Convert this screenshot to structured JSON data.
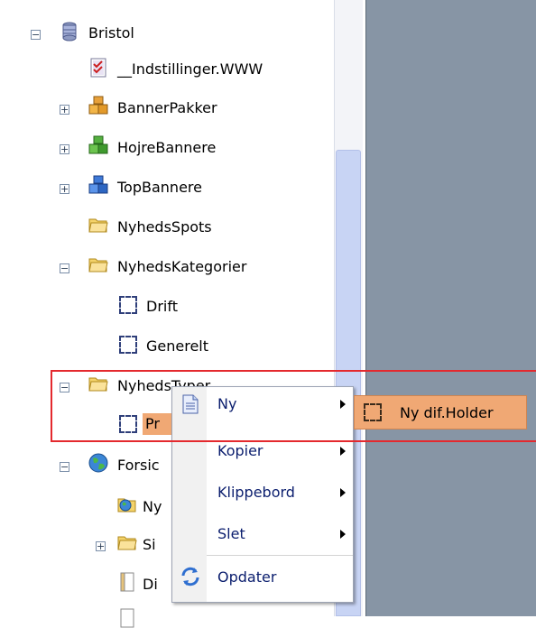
{
  "tree": {
    "root": {
      "label": "Bristol"
    },
    "items": [
      {
        "label": "__Indstillinger.WWW"
      },
      {
        "label": "BannerPakker"
      },
      {
        "label": "HojreBannere"
      },
      {
        "label": "TopBannere"
      },
      {
        "label": "NyhedsSpots"
      },
      {
        "label": "NyhedsKategorier"
      },
      {
        "label": "Drift"
      },
      {
        "label": "Generelt"
      },
      {
        "label": "NyhedsTyper"
      },
      {
        "label": "Pr"
      },
      {
        "label": "Forsic"
      },
      {
        "label": "Ny"
      },
      {
        "label": "Si"
      },
      {
        "label": "Di"
      }
    ]
  },
  "context_menu": {
    "items": [
      {
        "label": "Ny"
      },
      {
        "label": "Kopier"
      },
      {
        "label": "Klippebord"
      },
      {
        "label": "Slet"
      },
      {
        "label": "Opdater"
      }
    ],
    "submenu": {
      "label": "Ny dif.Holder"
    }
  },
  "colors": {
    "highlight": "#f0a874",
    "menu_text": "#0b1e6e",
    "red_outline": "#e4292e",
    "right_pane": "#8795a5"
  }
}
